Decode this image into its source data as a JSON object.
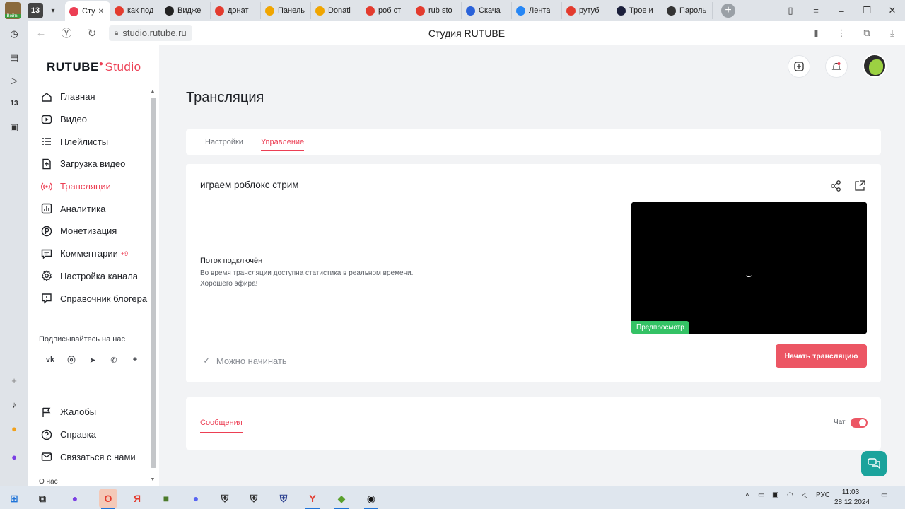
{
  "browser": {
    "window_title": "Студия RUTUBE",
    "url": "studio.rutube.ru",
    "profile_label": "Войти",
    "tab_counter": "13",
    "tabs": [
      {
        "label": "Сту",
        "color": "#ec3f54",
        "icon": "rutube-favicon",
        "active": true
      },
      {
        "label": "как под",
        "color": "#e33b2e",
        "icon": "yandex-favicon"
      },
      {
        "label": "Видже",
        "color": "#222222",
        "icon": "sparkle-favicon"
      },
      {
        "label": "донат",
        "color": "#e33b2e",
        "icon": "yandex-favicon"
      },
      {
        "label": "Панель",
        "color": "#f0a500",
        "icon": "donationalerts-favicon"
      },
      {
        "label": "Donati",
        "color": "#f0a500",
        "icon": "donationalerts-favicon"
      },
      {
        "label": "роб ст",
        "color": "#e33b2e",
        "icon": "yandex-favicon"
      },
      {
        "label": "rub sto",
        "color": "#e33b2e",
        "icon": "yandex-favicon"
      },
      {
        "label": "Скача",
        "color": "#2a62d9",
        "icon": "app-favicon"
      },
      {
        "label": "Лента",
        "color": "#2787f5",
        "icon": "vk-favicon"
      },
      {
        "label": "рутуб",
        "color": "#e33b2e",
        "icon": "yandex-favicon"
      },
      {
        "label": "Трое и",
        "color": "#1b1f3b",
        "icon": "rutube-r-favicon"
      },
      {
        "label": "Пароль",
        "color": "#333333",
        "icon": "google-favicon"
      }
    ]
  },
  "studio": {
    "logo_main": "RUTUBE",
    "logo_studio": "Studio",
    "menu": [
      {
        "label": "Главная",
        "icon": "home-icon",
        "key": "home"
      },
      {
        "label": "Видео",
        "icon": "video-icon",
        "key": "video"
      },
      {
        "label": "Плейлисты",
        "icon": "playlist-icon",
        "key": "playlists"
      },
      {
        "label": "Загрузка видео",
        "icon": "upload-icon",
        "key": "upload"
      },
      {
        "label": "Трансляции",
        "icon": "broadcast-icon",
        "key": "broadcasts",
        "active": true
      },
      {
        "label": "Аналитика",
        "icon": "analytics-icon",
        "key": "analytics"
      },
      {
        "label": "Монетизация",
        "icon": "ruble-icon",
        "key": "monetization"
      },
      {
        "label": "Комментарии",
        "icon": "comments-icon",
        "key": "comments",
        "badge": "+9"
      },
      {
        "label": "Настройка канала",
        "icon": "gear-icon",
        "key": "channel-settings"
      },
      {
        "label": "Справочник блогера",
        "icon": "info-icon",
        "key": "blogger-guide"
      }
    ],
    "follow_label": "Подписывайтесь на нас",
    "socials": [
      "vk-icon",
      "ok-icon",
      "telegram-icon",
      "viber-icon",
      "plus-icon"
    ],
    "menu_bottom": [
      {
        "label": "Жалобы",
        "icon": "flag-icon",
        "key": "complaints"
      },
      {
        "label": "Справка",
        "icon": "help-icon",
        "key": "help"
      },
      {
        "label": "Связаться с нами",
        "icon": "mail-icon",
        "key": "contact"
      }
    ],
    "about_label": "О нас"
  },
  "page": {
    "title": "Трансляция",
    "tabs": [
      {
        "label": "Настройки",
        "active": false
      },
      {
        "label": "Управление",
        "active": true
      }
    ],
    "stream": {
      "title": "играем роблокс стрим",
      "status_heading": "Поток подключён",
      "status_line1": "Во время трансляции доступна статистика в реальном времени.",
      "status_line2": "Хорошего эфира!",
      "preview_label": "Предпросмотр",
      "ready_label": "Можно начинать",
      "start_button": "Начать трансляцию"
    },
    "messages_tab": "Сообщения",
    "chat_label": "Чат",
    "chat_enabled": true
  },
  "taskbar": {
    "language": "РУС",
    "time": "11:03",
    "date": "28.12.2024"
  },
  "colors": {
    "accent": "#ec3f54",
    "start_button": "#ec5664",
    "preview_badge": "#34c265",
    "help_fab": "#1ba39c"
  }
}
